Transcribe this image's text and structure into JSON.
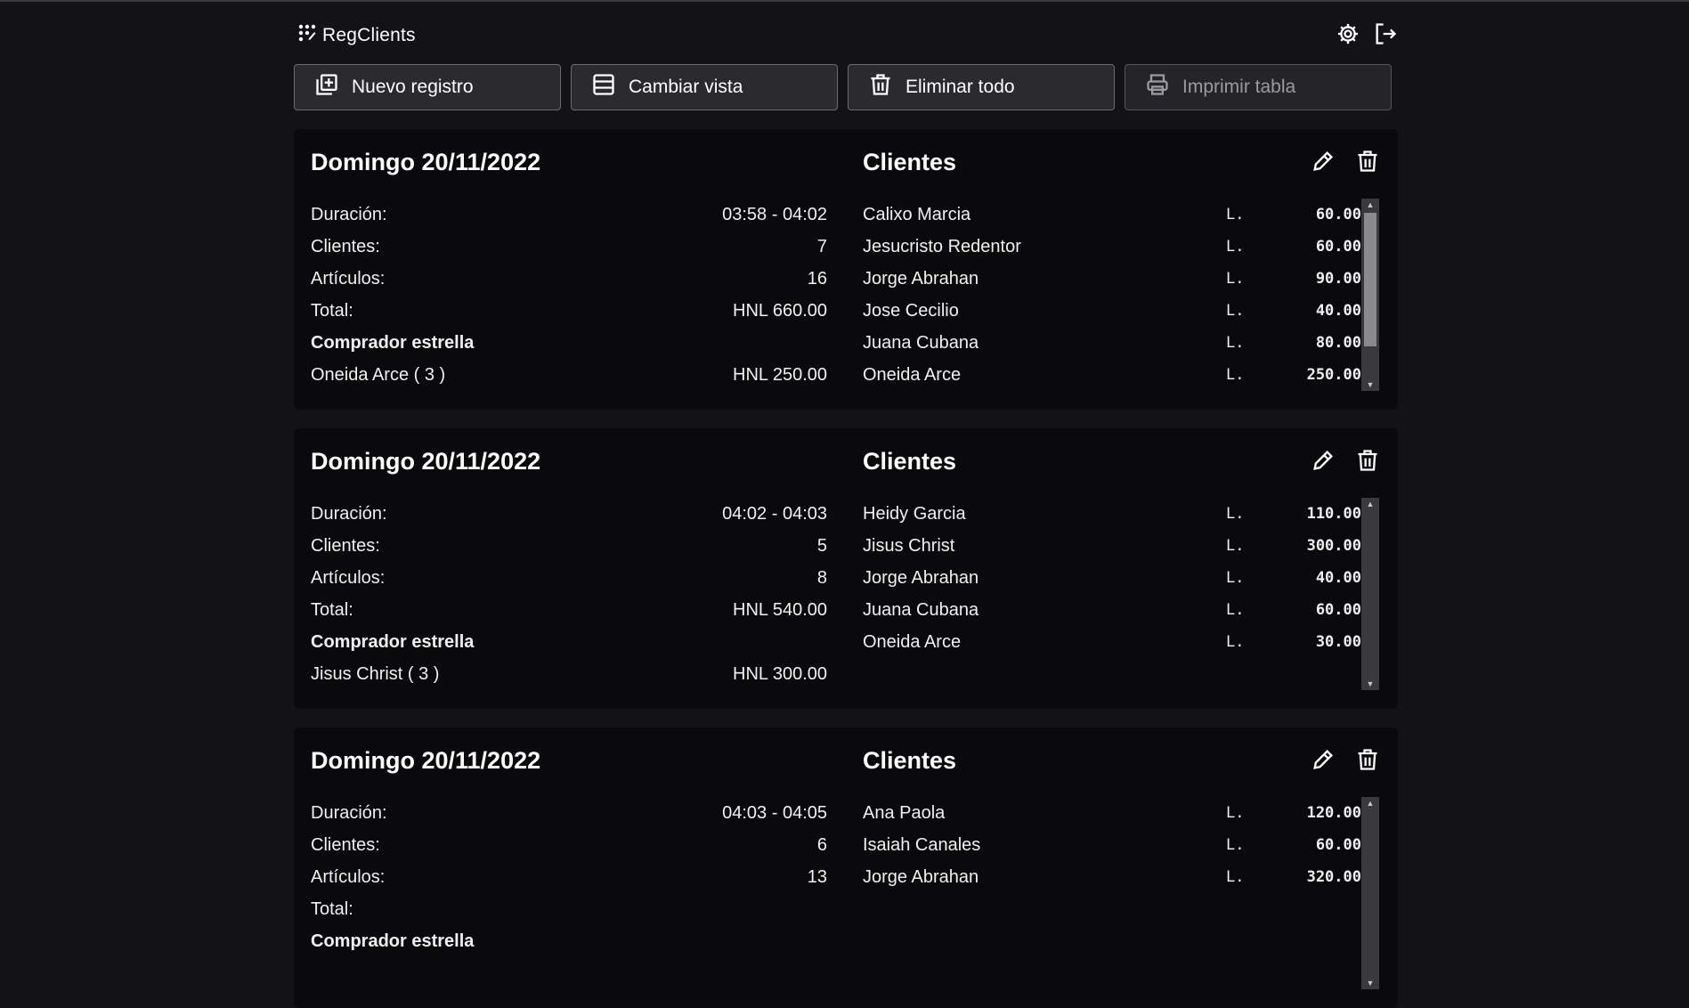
{
  "app": {
    "title": "RegClients"
  },
  "header_icons": [
    "gear-icon",
    "logout-icon"
  ],
  "toolbar": {
    "new_label": "Nuevo registro",
    "view_label": "Cambiar vista",
    "delete_all_label": "Eliminar todo",
    "print_label": "Imprimir tabla"
  },
  "labels": {
    "duration": "Duración:",
    "clients": "Clientes:",
    "articles": "Artículos:",
    "total": "Total:",
    "star_buyer": "Comprador estrella",
    "clients_heading": "Clientes",
    "currency": "L."
  },
  "colors": {
    "background": "#121217",
    "card": "#0a0a0d",
    "button": "#2a2a2f"
  },
  "cards": [
    {
      "date": "Domingo 20/11/2022",
      "duration": "03:58 - 04:02",
      "clients_count": "7",
      "articles": "16",
      "total": "HNL 660.00",
      "star_buyer": "Oneida Arce ( 3 )",
      "star_amount": "HNL 250.00",
      "clients": [
        {
          "name": "Calixo Marcia",
          "amount": "60.00"
        },
        {
          "name": "Jesucristo Redentor",
          "amount": "60.00"
        },
        {
          "name": "Jorge Abrahan",
          "amount": "90.00"
        },
        {
          "name": "Jose Cecilio",
          "amount": "40.00"
        },
        {
          "name": "Juana Cubana",
          "amount": "80.00"
        },
        {
          "name": "Oneida Arce",
          "amount": "250.00"
        }
      ]
    },
    {
      "date": "Domingo 20/11/2022",
      "duration": "04:02 - 04:03",
      "clients_count": "5",
      "articles": "8",
      "total": "HNL 540.00",
      "star_buyer": "Jisus Christ ( 3 )",
      "star_amount": "HNL 300.00",
      "clients": [
        {
          "name": "Heidy Garcia",
          "amount": "110.00"
        },
        {
          "name": "Jisus Christ",
          "amount": "300.00"
        },
        {
          "name": "Jorge Abrahan",
          "amount": "40.00"
        },
        {
          "name": "Juana Cubana",
          "amount": "60.00"
        },
        {
          "name": "Oneida Arce",
          "amount": "30.00"
        }
      ]
    },
    {
      "date": "Domingo 20/11/2022",
      "duration": "04:03 - 04:05",
      "clients_count": "6",
      "articles": "13",
      "total": "",
      "star_buyer": "",
      "star_amount": "",
      "clients": [
        {
          "name": "Ana Paola",
          "amount": "120.00"
        },
        {
          "name": "Isaiah Canales",
          "amount": "60.00"
        },
        {
          "name": "Jorge Abrahan",
          "amount": "320.00"
        }
      ]
    }
  ]
}
